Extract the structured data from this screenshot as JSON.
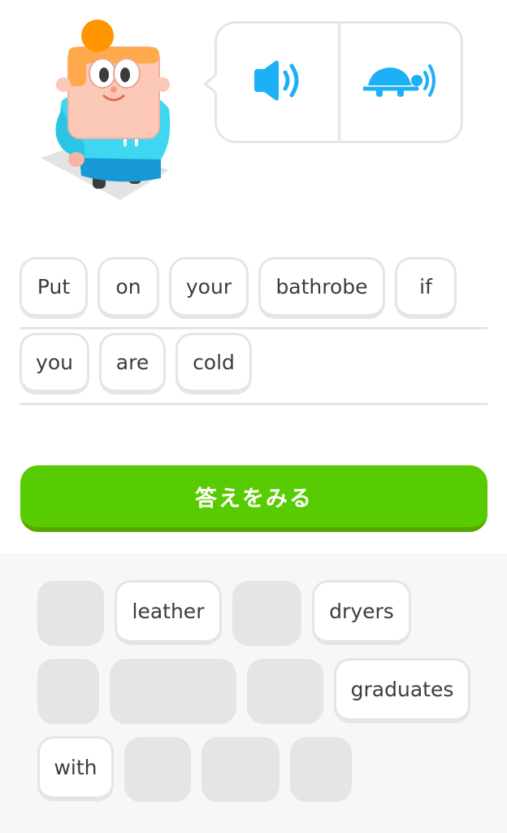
{
  "answer": {
    "line1": [
      "Put",
      "on",
      "your",
      "bathrobe",
      "if"
    ],
    "line2": [
      "you",
      "are",
      "cold"
    ]
  },
  "check_button_label": "答えをみる",
  "bank": {
    "words": [
      "leather",
      "dryers",
      "graduates",
      "with"
    ]
  },
  "colors": {
    "accent_green": "#58cc02",
    "audio_blue": "#1cb0f6",
    "tile_border": "#e5e5e5"
  },
  "icons": [
    "speaker-icon",
    "slow-turtle-icon"
  ]
}
